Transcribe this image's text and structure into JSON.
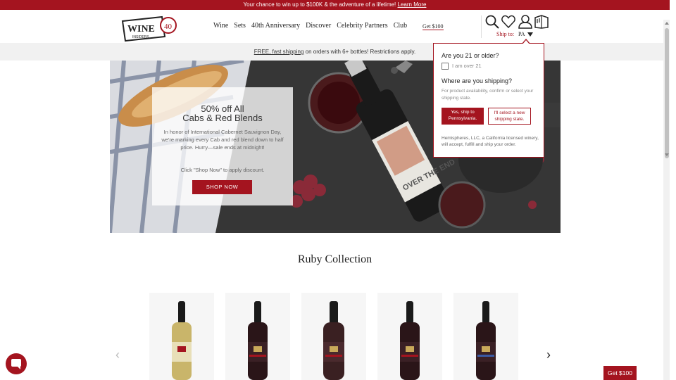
{
  "promo": {
    "text": "Your chance to win up to $100K & the adventure of a lifetime!",
    "link": "Learn More"
  },
  "header": {
    "logo_text": "WINE",
    "logo_sub": "INSIDERS",
    "logo_badge": "40",
    "nav": [
      "Wine",
      "Sets",
      "40th Anniversary",
      "Discover",
      "Celebrity Partners",
      "Club"
    ],
    "get100": "Get $100",
    "ship_to_label": "Ship to:",
    "ship_state": "PA"
  },
  "shipbar": {
    "link": "FREE, fast shipping",
    "text": " on orders with 6+ bottles! Restrictions apply."
  },
  "hero": {
    "title_line1": "50% off All",
    "title_line2": "Cabs & Red Blends",
    "body": "In honor of International Cabernet Sauvignon Day, we're marking every Cab and red blend down to half price. Hurry—sale ends at midnight!",
    "click_text": "Click \"Shop Now\" to apply discount.",
    "button": "SHOP NOW",
    "bottle_label": "OVER THE END"
  },
  "section": {
    "title": "Ruby Collection"
  },
  "products": [
    {
      "name": "white-wine-bottle",
      "color": "#c9b56a"
    },
    {
      "name": "red-wine-bottle",
      "color": "#2a1518"
    },
    {
      "name": "sparkling-red-bottle",
      "color": "#3a2022"
    },
    {
      "name": "red-wine-bottle",
      "color": "#2a1518"
    },
    {
      "name": "red-wine-bottle",
      "color": "#2a1518"
    }
  ],
  "carousel": {
    "prev": "‹",
    "next": "›"
  },
  "floating": {
    "get100": "Get $100"
  },
  "popover": {
    "q1": "Are you 21 or older?",
    "checkbox_label": "I am over 21",
    "q2": "Where are you shipping?",
    "desc": "For product availability, confirm or select your shipping state.",
    "yes_button": "Yes, ship to Pennsylvania.",
    "new_button": "I'll select a new shipping state.",
    "legal": "Hemispheres, LLC, a California licensed winery, will accept, fulfill and ship your order."
  },
  "colors": {
    "brand": "#a4141f"
  }
}
